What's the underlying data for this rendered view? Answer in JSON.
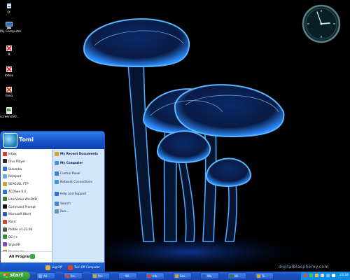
{
  "desktop": {
    "icons": [
      {
        "label": "O:",
        "icon": "drive-icon"
      },
      {
        "label": "My Computer",
        "icon": "computer-icon"
      },
      {
        "label": "B",
        "icon": "broken-shortcut-icon"
      },
      {
        "label": "Inbox",
        "icon": "broken-shortcut-icon"
      },
      {
        "label": "Favo",
        "icon": "broken-shortcut-icon"
      },
      {
        "label": "screenshO...",
        "icon": "image-file-icon"
      }
    ]
  },
  "start_menu": {
    "user_name": "Tomi",
    "left_items": [
      {
        "label": "Inbox",
        "color": "#d23b2e"
      },
      {
        "label": "Divx Player",
        "color": "#2a2a2a"
      },
      {
        "label": "Bulumba",
        "color": "#2f6fd6"
      },
      {
        "label": "Notepad",
        "color": "#6fa6d8"
      },
      {
        "label": "SEAGULL FTP",
        "color": "#c7a23b"
      },
      {
        "label": "ACDSee 6.0",
        "color": "#2e74c9"
      },
      {
        "label": "InterVideo WinDVD",
        "color": "#3a7a3a"
      },
      {
        "label": "Command Prompt",
        "color": "#111111"
      },
      {
        "label": "Microsoft Word",
        "color": "#2b5bb8"
      },
      {
        "label": "Paint",
        "color": "#c74a3a"
      },
      {
        "label": "Prober v1.21.06",
        "color": "#555555"
      },
      {
        "label": "DC++",
        "color": "#2d8f2d"
      },
      {
        "label": "StyleXP",
        "color": "#7a4ab8"
      },
      {
        "label": "Rainlendar",
        "color": "#d28b2d"
      },
      {
        "label": "MSN Messenger 6.2",
        "color": "#3d9a3d"
      }
    ],
    "all_programs_label": "All Programs",
    "right_items": [
      {
        "label": "My Recent Documents",
        "bold": true,
        "color": "#d8a330"
      },
      {
        "label": "My Computer",
        "bold": true,
        "color": "#4f8fd8"
      },
      {
        "label": "Control Panel",
        "bold": false,
        "color": "#3e7fd0"
      },
      {
        "label": "Network Connections",
        "bold": false,
        "color": "#3a9ad0"
      },
      {
        "label": "Help and Support",
        "bold": false,
        "color": "#2e6fcf"
      },
      {
        "label": "Search",
        "bold": false,
        "color": "#4b84c8"
      },
      {
        "label": "Run...",
        "bold": false,
        "color": "#6b8fb8"
      }
    ],
    "log_off_label": "Log Off",
    "turn_off_label": "Turn Off Computer"
  },
  "taskbar": {
    "start_label": "start",
    "tasks": [
      {
        "label": "Ad...",
        "color": "#6fb0e8"
      },
      {
        "label": "Pai...",
        "color": "#c74a3a"
      },
      {
        "label": "Pal...",
        "color": "#d8a330"
      },
      {
        "label": "Wi...",
        "color": "#2e74c9"
      },
      {
        "label": "Inb...",
        "color": "#d23b2e"
      },
      {
        "label": "Ses...",
        "color": "#d8a330"
      },
      {
        "label": "Wo...",
        "color": "#2b5bb8"
      },
      {
        "label": "Wi...",
        "color": "#3a7a3a"
      },
      {
        "label": "Ta...",
        "color": "#d8a330"
      }
    ],
    "clock_time": "23:34"
  },
  "watermark": "digitalblasphemy.com",
  "colors": {
    "taskbar_blue": "#1d4fbf",
    "start_green": "#3a9e37",
    "tray_blue": "#0f8ee6",
    "menu_header_blue": "#1752c8"
  }
}
